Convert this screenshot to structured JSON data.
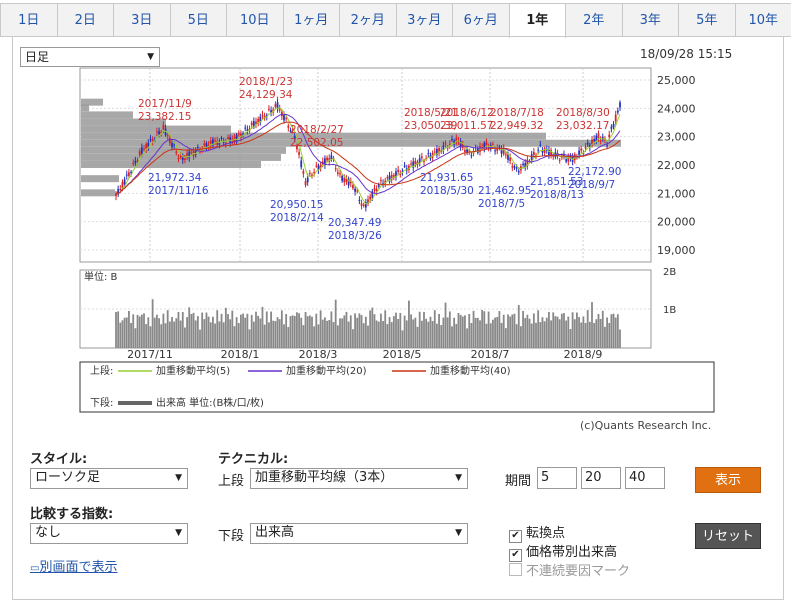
{
  "tabs": [
    "1日",
    "2日",
    "3日",
    "5日",
    "10日",
    "1ヶ月",
    "2ヶ月",
    "3ヶ月",
    "6ヶ月",
    "1年",
    "2年",
    "3年",
    "5年",
    "10年"
  ],
  "active_tab": "1年",
  "period_select": "日足",
  "timestamp": "18/09/28 15:15",
  "chart": {
    "y_ticks": [
      "25,000",
      "24,000",
      "23,000",
      "22,000",
      "21,000",
      "20,000",
      "19,000"
    ],
    "volume_unit": "単位: B",
    "volume_ticks": [
      "2B",
      "1B"
    ],
    "x_ticks": [
      "2017/11",
      "2018/1",
      "2018/3",
      "2018/5",
      "2018/7",
      "2018/9"
    ],
    "annotations_high": [
      {
        "date": "2017/11/9",
        "value": "23,382.15"
      },
      {
        "date": "2018/1/23",
        "value": "24,129.34"
      },
      {
        "date": "2018/2/27",
        "value": "22,502.05"
      },
      {
        "date": "2018/5/21",
        "value": "23,050.39"
      },
      {
        "date": "2018/6/12",
        "value": "23,011.57"
      },
      {
        "date": "2018/7/18",
        "value": "22,949.32"
      },
      {
        "date": "2018/8/30",
        "value": "23,032.17"
      }
    ],
    "annotations_low": [
      {
        "date": "2017/11/16",
        "value": "21,972.34"
      },
      {
        "date": "2018/2/14",
        "value": "20,950.15"
      },
      {
        "date": "2018/3/26",
        "value": "20,347.49"
      },
      {
        "date": "2018/5/30",
        "value": "21,931.65"
      },
      {
        "date": "2018/7/5",
        "value": "21,462.95"
      },
      {
        "date": "2018/8/13",
        "value": "21,851.53"
      },
      {
        "date": "2018/9/7",
        "value": "22,172.90"
      }
    ],
    "legend": {
      "upper_label": "上段:",
      "ma5": "加重移動平均(5)",
      "ma20": "加重移動平均(20)",
      "ma40": "加重移動平均(40)",
      "lower_label": "下段:",
      "volume": "出来高 単位:(B株/口/枚)"
    },
    "colors": {
      "ma5": "#99cc33",
      "ma20": "#6633cc",
      "ma40": "#cc3311",
      "up": "#dd2222",
      "down": "#2233bb",
      "volume": "#888888",
      "high_text": "#cc3333",
      "low_text": "#3344cc"
    }
  },
  "copyright": "(c)Quants Research Inc.",
  "controls": {
    "style_label": "スタイル:",
    "style_value": "ローソク足",
    "tech_label": "テクニカル:",
    "upper_label": "上段",
    "upper_value": "加重移動平均線（3本）",
    "period_label": "期間",
    "periods": [
      "5",
      "20",
      "40"
    ],
    "show_button": "表示",
    "compare_label": "比較する指数:",
    "compare_value": "なし",
    "lower_label": "下段",
    "lower_value": "出来高",
    "reset_button": "リセット",
    "checkboxes": [
      {
        "label": "転換点",
        "checked": true
      },
      {
        "label": "価格帯別出来高",
        "checked": true
      },
      {
        "label": "不連続要因マーク",
        "checked": false
      }
    ],
    "popup_link": "別画面で表示"
  }
}
